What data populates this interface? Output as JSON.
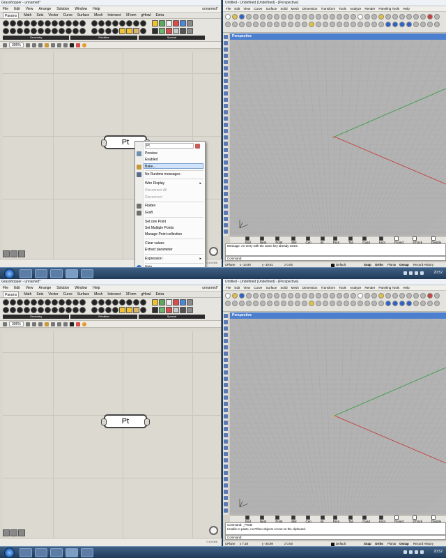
{
  "grasshopper": {
    "title": "Grasshopper - unnamed*",
    "menu": [
      "File",
      "Edit",
      "View",
      "Arrange",
      "Solution",
      "Window",
      "Help"
    ],
    "doc_label": "unnamed*",
    "tabs": [
      "Params",
      "Math",
      "Sets",
      "Vector",
      "Curve",
      "Surface",
      "Mesh",
      "Intersect",
      "XForm",
      "gHowl",
      "Extra"
    ],
    "sections": [
      "Geometry",
      "Primitive",
      "Special"
    ],
    "zoom": "305%",
    "node_label": "Pt",
    "version": "0.8.0066"
  },
  "context_menu": {
    "name_field": "Pt",
    "items": [
      {
        "label": "Preview",
        "disabled": false
      },
      {
        "label": "Enabled",
        "disabled": false
      },
      {
        "label": "Bake...",
        "disabled": false,
        "highlighted": true
      },
      {
        "label": "No Runtime messages",
        "disabled": false
      },
      {
        "label": "Wire Display",
        "disabled": false,
        "submenu": true
      },
      {
        "label": "Disconnect All",
        "disabled": true
      },
      {
        "label": "Disconnect",
        "disabled": true
      },
      {
        "label": "Flatten",
        "disabled": false
      },
      {
        "label": "Graft",
        "disabled": false
      },
      {
        "label": "Set one Point",
        "disabled": false
      },
      {
        "label": "Set Multiple Points",
        "disabled": false
      },
      {
        "label": "Manage Point collection",
        "disabled": false
      },
      {
        "label": "Clear values",
        "disabled": false
      },
      {
        "label": "Extract parameter",
        "disabled": false
      },
      {
        "label": "Expression",
        "disabled": false,
        "submenu": true
      },
      {
        "label": "Help...",
        "disabled": false
      }
    ]
  },
  "rhino": {
    "title": "Untitled - Undefined (Undefined) - [Perspective]",
    "menu": [
      "File",
      "Edit",
      "View",
      "Curve",
      "Surface",
      "Solid",
      "Mesh",
      "Dimension",
      "Transform",
      "Tools",
      "Analyze",
      "Render",
      "Paneling Tools",
      "Help"
    ],
    "viewport": "Perspective",
    "osnaps": [
      {
        "label": "End",
        "on": true
      },
      {
        "label": "Near",
        "on": true
      },
      {
        "label": "Point",
        "on": true
      },
      {
        "label": "Mid",
        "on": true
      },
      {
        "label": "Cen",
        "on": true
      },
      {
        "label": "Int",
        "on": true
      },
      {
        "label": "Perp",
        "on": true
      },
      {
        "label": "Tan",
        "on": true
      },
      {
        "label": "Quad",
        "on": true
      },
      {
        "label": "Knot",
        "on": true
      },
      {
        "label": "Project",
        "on": false
      },
      {
        "label": "STrack",
        "on": false
      },
      {
        "label": "Disable",
        "on": false
      }
    ],
    "top": {
      "history": [
        "Message: An entry with the same key already exists."
      ],
      "command": "Command:",
      "cplane": "CPlane",
      "x": "x -14.90",
      "y": "y -19.81",
      "z": "z 0.00"
    },
    "bottom": {
      "history": [
        "Command: _Paste",
        "Unable to paste, no Rhino objects or text on the clipboard."
      ],
      "command": "Command:",
      "cplane": "CPlane",
      "x": "x 7.28",
      "y": "y -25.89",
      "z": "z 0.00"
    },
    "layer": "Default",
    "status_toggles": [
      "Snap",
      "Ortho",
      "Planar",
      "Osnap",
      "Record History"
    ]
  },
  "taskbar": {
    "clock": "20:52"
  },
  "colors": {
    "viewport_title": "#4d7fcf",
    "x_axis": "#c83232",
    "y_axis": "#2f9a3b",
    "menu_highlight": "#cfe3fb"
  }
}
